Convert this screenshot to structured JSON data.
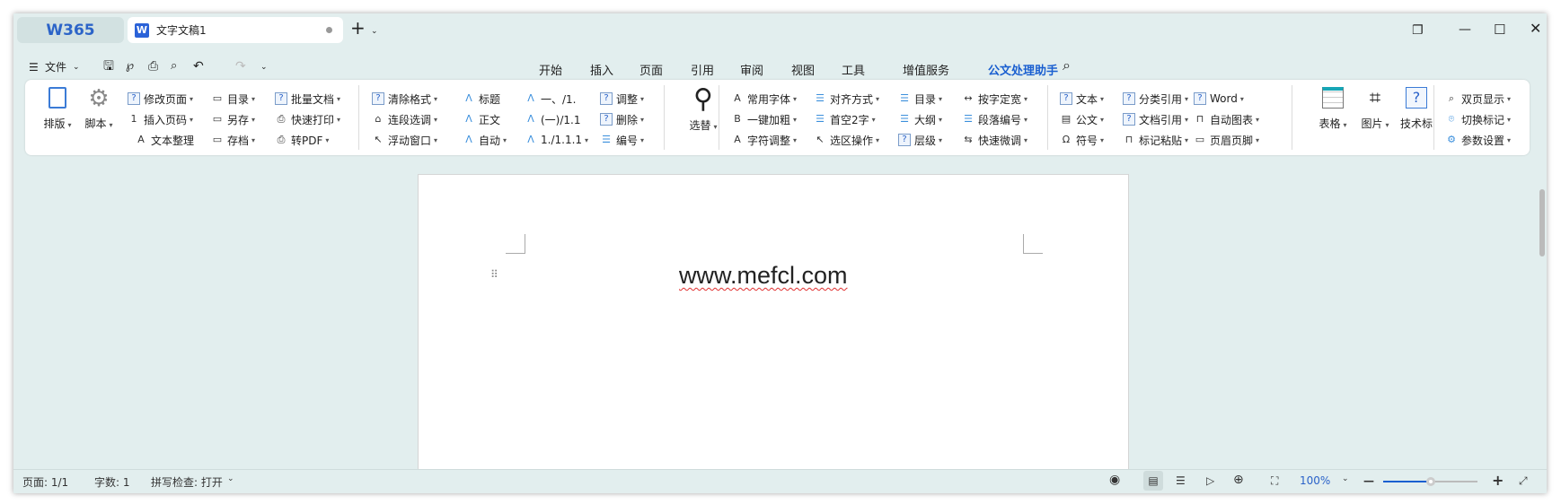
{
  "app": {
    "logo": "W365",
    "doc_tab": "文字文稿1",
    "doc_icon": "W",
    "new_tab": "+"
  },
  "quick": {
    "file_menu": "文件"
  },
  "menu": {
    "tabs": [
      "开始",
      "插入",
      "页面",
      "引用",
      "审阅",
      "视图",
      "工具",
      "增值服务",
      "公文处理助手"
    ],
    "active": 8
  },
  "ribbon": {
    "big": {
      "paiban": "排版",
      "jiaoben": "脚本",
      "xuanti": "选替",
      "table": "表格",
      "picture": "图片",
      "tech": "技术标"
    },
    "columns": [
      [
        {
          "l": "修改页面",
          "i": "?",
          "d": 1
        },
        {
          "l": "插入页码",
          "i": "1",
          "d": 1
        },
        {
          "l": "文本整理",
          "i": "A",
          "d": 0
        }
      ],
      [
        {
          "l": "目录",
          "i": "▭",
          "d": 1
        },
        {
          "l": "另存",
          "i": "▭",
          "d": 1
        },
        {
          "l": "存档",
          "i": "▭",
          "d": 1
        }
      ],
      [
        {
          "l": "批量文档",
          "i": "?",
          "d": 1
        },
        {
          "l": "快速打印",
          "i": "⎙",
          "d": 1
        },
        {
          "l": "转PDF",
          "i": "⎙",
          "d": 1
        }
      ],
      [
        {
          "l": "清除格式",
          "i": "?",
          "d": 1
        },
        {
          "l": "连段选调",
          "i": "⌂",
          "d": 1
        },
        {
          "l": "浮动窗口",
          "i": "↖",
          "d": 1
        }
      ],
      [
        {
          "l": "标题",
          "i": "Ʌ",
          "d": 0
        },
        {
          "l": "正文",
          "i": "Ʌ",
          "d": 0
        },
        {
          "l": "自动",
          "i": "Ʌ",
          "d": 1
        }
      ],
      [
        {
          "l": "一、/1.",
          "i": "Ʌ",
          "d": 0
        },
        {
          "l": "(一)/1.1",
          "i": "Ʌ",
          "d": 0
        },
        {
          "l": "1./1.1.1",
          "i": "Ʌ",
          "d": 1
        }
      ],
      [
        {
          "l": "调整",
          "i": "?",
          "d": 1
        },
        {
          "l": "删除",
          "i": "?",
          "d": 1
        },
        {
          "l": "编号",
          "i": "☰",
          "d": 1
        }
      ],
      [
        {
          "l": "常用字体",
          "i": "A",
          "d": 1
        },
        {
          "l": "一键加粗",
          "i": "B",
          "d": 1
        },
        {
          "l": "字符调整",
          "i": "A",
          "d": 1
        }
      ],
      [
        {
          "l": "对齐方式",
          "i": "☰",
          "d": 1
        },
        {
          "l": "首空2字",
          "i": "☰",
          "d": 1
        },
        {
          "l": "选区操作",
          "i": "↖",
          "d": 1
        }
      ],
      [
        {
          "l": "目录",
          "i": "☰",
          "d": 1
        },
        {
          "l": "大纲",
          "i": "☰",
          "d": 1
        },
        {
          "l": "层级",
          "i": "?",
          "d": 1
        }
      ],
      [
        {
          "l": "按字定宽",
          "i": "↔",
          "d": 1
        },
        {
          "l": "段落编号",
          "i": "☰",
          "d": 1
        },
        {
          "l": "快速微调",
          "i": "⇆",
          "d": 1
        }
      ],
      [
        {
          "l": "文本",
          "i": "?",
          "d": 1
        },
        {
          "l": "公文",
          "i": "▤",
          "d": 1
        },
        {
          "l": "符号",
          "i": "Ω",
          "d": 1
        }
      ],
      [
        {
          "l": "分类引用",
          "i": "?",
          "d": 1
        },
        {
          "l": "文档引用",
          "i": "?",
          "d": 1
        },
        {
          "l": "标记粘贴",
          "i": "⊓",
          "d": 1
        }
      ],
      [
        {
          "l": "Word",
          "i": "?",
          "d": 1
        },
        {
          "l": "自动图表",
          "i": "⊓",
          "d": 1
        },
        {
          "l": "页眉页脚",
          "i": "▭",
          "d": 1
        }
      ],
      [
        {
          "l": "双页显示",
          "i": "⌕",
          "d": 1
        },
        {
          "l": "切换标记",
          "i": "⌾",
          "d": 1
        },
        {
          "l": "参数设置",
          "i": "⚙",
          "d": 1
        }
      ]
    ]
  },
  "document": {
    "text": "www.mefcl.com"
  },
  "status": {
    "page": "页面: 1/1",
    "words": "字数: 1",
    "spell": "拼写检查: 打开",
    "zoom": "100%",
    "zoom_fraction": 0.5
  },
  "colors": {
    "accent": "#1a5fd0",
    "bg": "#e2eeee"
  }
}
